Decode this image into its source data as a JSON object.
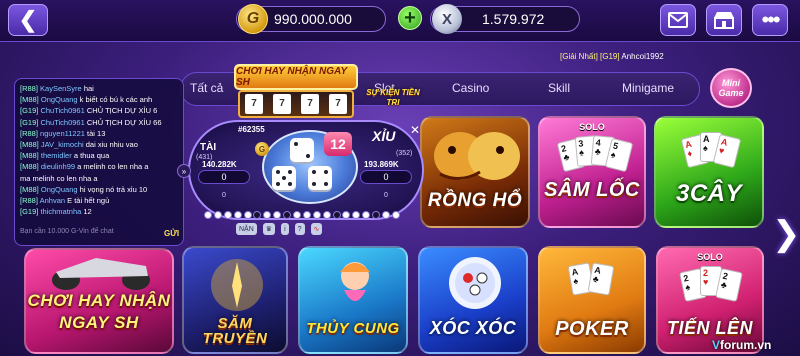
{
  "header": {
    "back_icon": "chevron-left-icon",
    "gold_balance": "990.000.000",
    "gold_coin_letter": "G",
    "silver_balance": "1.579.972",
    "silver_coin_letter": "X",
    "add_label": "+",
    "right_icons": [
      "mail-icon",
      "shop-icon",
      "more-icon"
    ]
  },
  "tabs": [
    "Tất cả",
    "Slot",
    "Casino",
    "Skill",
    "Minigame"
  ],
  "mini_game_label": "Mini Game",
  "online_text": {
    "prefix": "[Giải Nhất]",
    "mid": "[G19]",
    "user": "Anhcoi1992"
  },
  "chat": {
    "messages": [
      {
        "server": "[R88]",
        "user": "KaySenSyre",
        "text": "hai"
      },
      {
        "server": "[M88]",
        "user": "OngQuang",
        "text": "k biết có bú k các anh"
      },
      {
        "server": "[G19]",
        "user": "ChuTich0961",
        "text": "CHỦ TỊCH DỰ XỈU 6"
      },
      {
        "server": "[G19]",
        "user": "ChuTich0961",
        "text": "CHỦ TỊCH DỰ XỈU 66"
      },
      {
        "server": "[R88]",
        "user": "nguyen11221",
        "text": "tài 13"
      },
      {
        "server": "[M88]",
        "user": "JAV_kimochi",
        "text": "dai xiu nhiu vao"
      },
      {
        "server": "[M88]",
        "user": "themidler",
        "text": "a thua qua"
      },
      {
        "server": "[M88]",
        "user": "dieulinh99",
        "text": "a melinh co len nha a"
      },
      {
        "server": "",
        "user": "",
        "text": "ma melinh co len nha a"
      },
      {
        "server": "[M88]",
        "user": "OngQuang",
        "text": "hi vọng nó trả xỉu 10"
      },
      {
        "server": "[R88]",
        "user": "Anhvan",
        "text": "E tài hết ngủ"
      },
      {
        "server": "[G19]",
        "user": "thichmatnha",
        "text": "12"
      }
    ],
    "input_placeholder": "Bạn cần 10.000 G-Vin để chat",
    "send_label": "GỬI",
    "toggle_icon": "expand-right-icon"
  },
  "tai_xiu": {
    "promo_banner": "CHƠI HAY NHẬN NGAY SH",
    "event_badge": "SỰ KIỆN TIỀN TRI",
    "session_id": "#62355",
    "timer": "12",
    "tai": {
      "label": "TÀI",
      "count": "(431)",
      "pot": "140.282K",
      "my_bet": "0",
      "sub": "0"
    },
    "xiu": {
      "label": "XỈU",
      "count": "(352)",
      "pot": "193.869K",
      "my_bet": "0",
      "sub": "0"
    },
    "history": [
      "white",
      "white",
      "white",
      "white",
      "white",
      "dark",
      "white",
      "white",
      "dark",
      "white",
      "white",
      "white",
      "white",
      "dark",
      "white",
      "white",
      "white",
      "dark",
      "white",
      "white"
    ],
    "tools": [
      "NẶN",
      "trophy-icon",
      "info-icon",
      "help-icon",
      "chart-icon"
    ],
    "close_icon": "close-icon"
  },
  "games": [
    {
      "name": "RỒNG HỔ",
      "badge": ""
    },
    {
      "name": "SÂM LỐC",
      "badge": "SOLO"
    },
    {
      "name": "3CÂY",
      "badge": ""
    },
    {
      "name": "CHƠI HAY NHẬN NGAY SH",
      "badge": ""
    },
    {
      "name": "SĂM TRUYỀN",
      "badge": ""
    },
    {
      "name": "THỦY CUNG",
      "badge": ""
    },
    {
      "name": "XÓC XÓC",
      "badge": ""
    },
    {
      "name": "POKER",
      "badge": ""
    },
    {
      "name": "TIẾN LÊN",
      "badge": "SOLO"
    }
  ],
  "watermark": {
    "v": "V",
    "rest": "forum.vn"
  },
  "colors": {
    "accent": "#6a4bd0",
    "gold": "#ffce3a",
    "bg": "#3c1f7d"
  }
}
